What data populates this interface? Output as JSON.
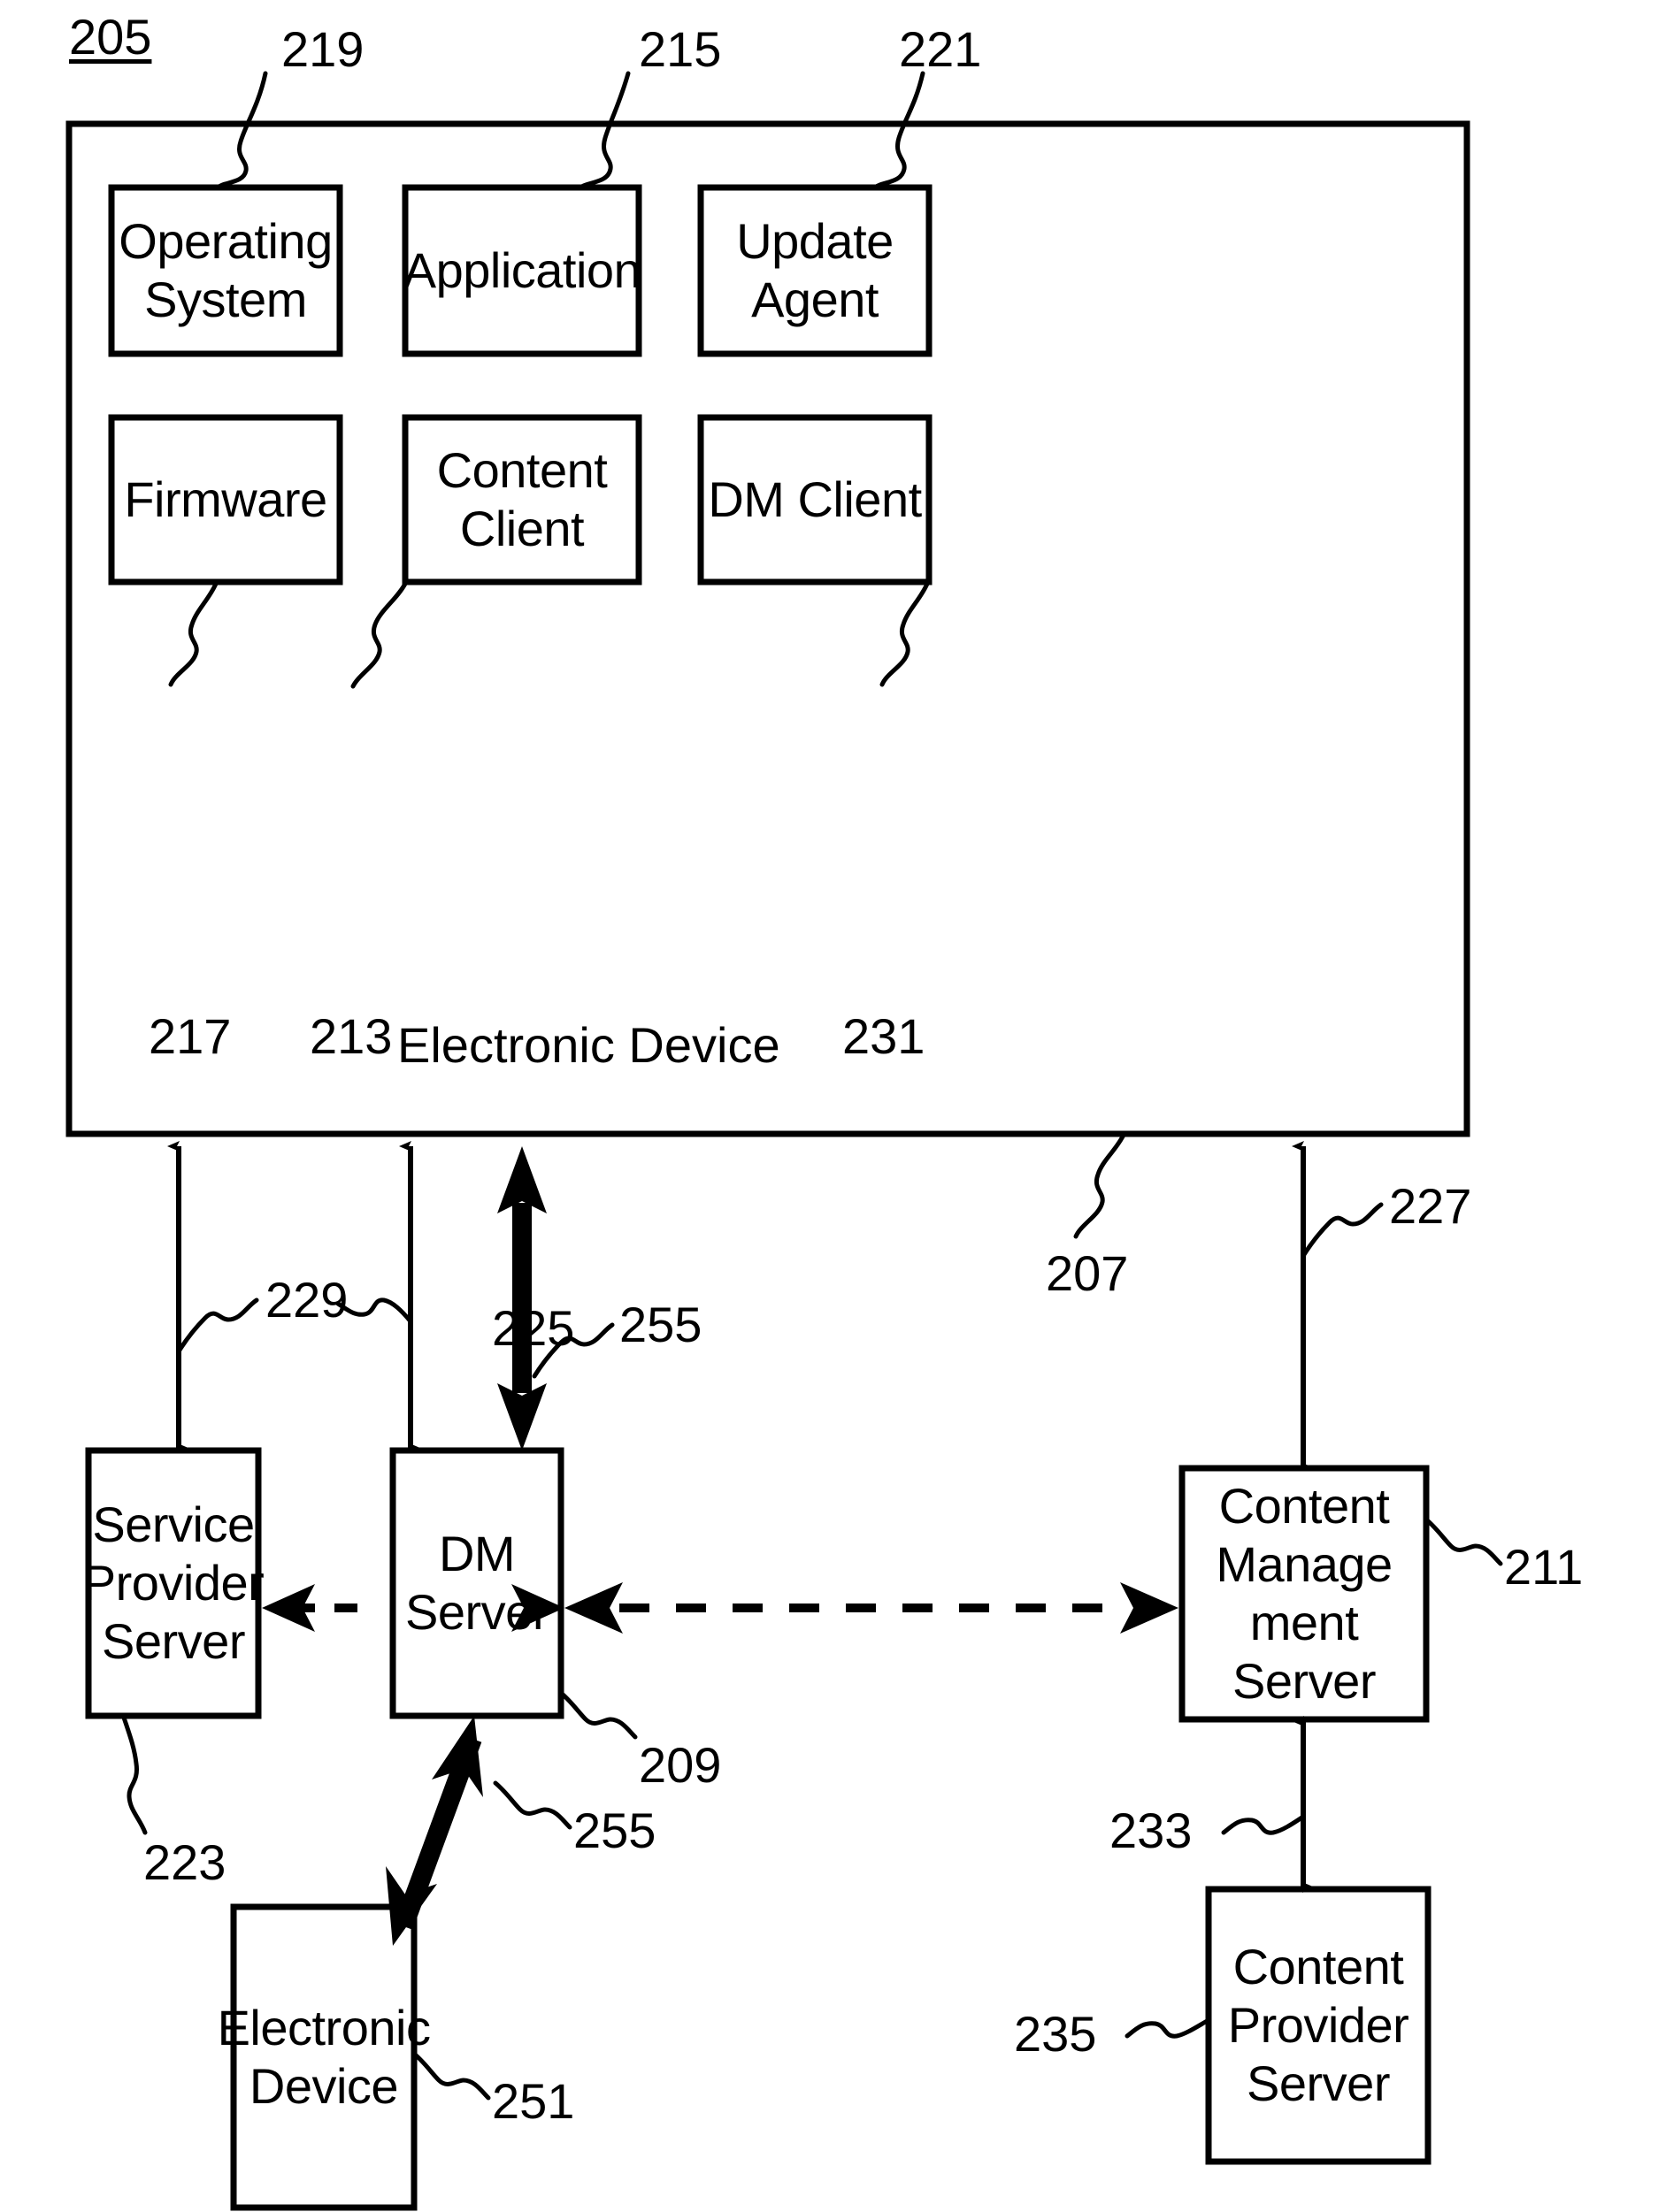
{
  "figure": {
    "figure_number": "205",
    "device_container_label": "Electronic Device",
    "device_modules": [
      {
        "id": "operating-system",
        "label": "Operating\nSystem",
        "ref": "219"
      },
      {
        "id": "application",
        "label": "Application",
        "ref": "215"
      },
      {
        "id": "update-agent",
        "label": "Update Agent",
        "ref": "221"
      },
      {
        "id": "firmware",
        "label": "Firmware",
        "ref": "217"
      },
      {
        "id": "content-client",
        "label": "Content Client",
        "ref": "213"
      },
      {
        "id": "dm-client",
        "label": "DM Client",
        "ref": "231"
      }
    ],
    "device_container_ref": "207",
    "lower_nodes": [
      {
        "id": "service-provider-server",
        "label": "Service\nProvider\nServer",
        "ref": "223"
      },
      {
        "id": "dm-server",
        "label": "DM\nServer",
        "ref": "209"
      },
      {
        "id": "content-management-server",
        "label": "Content\nManage\nment\nServer",
        "ref": "211"
      },
      {
        "id": "electronic-device-peer",
        "label": "Electronic\nDevice",
        "ref": "251"
      },
      {
        "id": "content-provider-server",
        "label": "Content\nProvider\nServer",
        "ref": "235"
      }
    ],
    "connection_refs": {
      "device_to_service_provider": "229",
      "device_to_dm_server": "225",
      "device_to_dm_server_thick": "255",
      "device_to_content_management": "227",
      "content_mgmt_to_content_provider": "233",
      "peer_device_to_dm_server_thick": "255"
    },
    "colors": {
      "line": "#000000",
      "background": "#ffffff",
      "text": "#000000"
    }
  }
}
